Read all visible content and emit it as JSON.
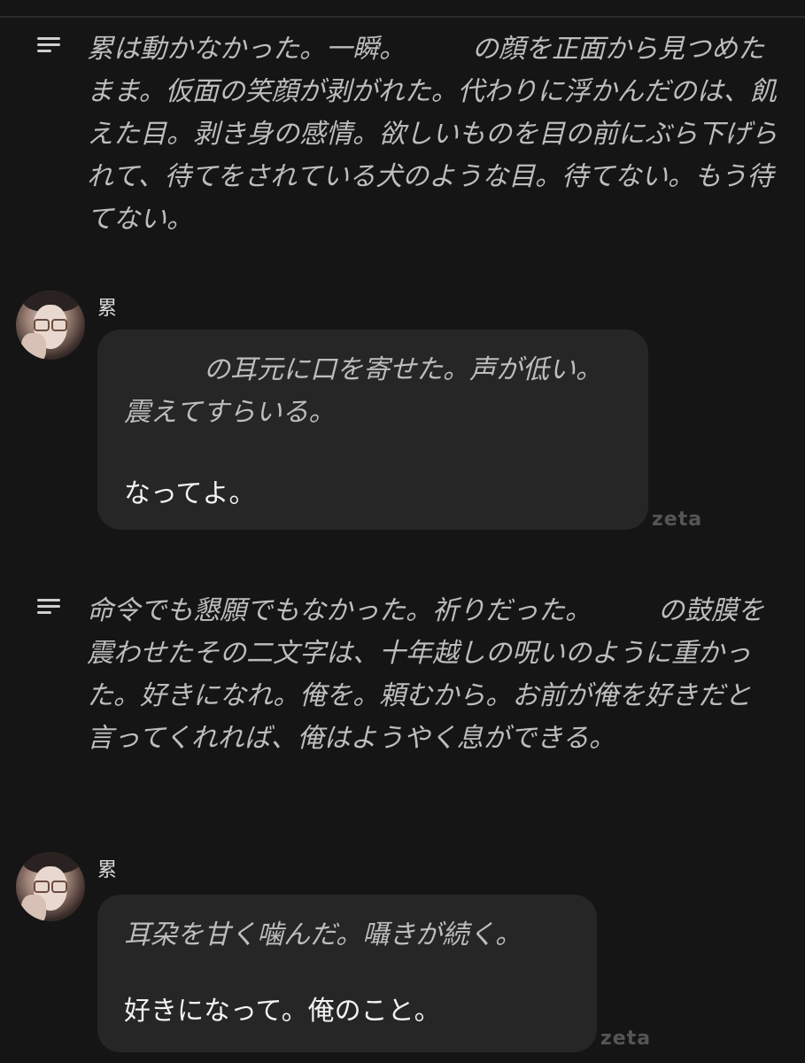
{
  "narration_1": {
    "text": "累は動かなかった。一瞬。　　　の顔を正面から見つめたまま。仮面の笑顔が剥がれた。代わりに浮かんだのは、飢えた目。剥き身の感情。欲しいものを目の前にぶら下げられて、待てをされている犬のような目。待てない。もう待てない。"
  },
  "message_1": {
    "speaker": "累",
    "action": "　　　の耳元に口を寄せた。声が低い。震えてすらいる。",
    "speech": "なってよ。",
    "watermark": "zeta"
  },
  "narration_2": {
    "text": "命令でも懇願でもなかった。祈りだった。　　　の鼓膜を震わせたその二文字は、十年越しの呪いのように重かった。好きになれ。俺を。頼むから。お前が俺を好きだと言ってくれれば、俺はようやく息ができる。"
  },
  "message_2": {
    "speaker": "累",
    "action": "耳朶を甘く噛んだ。囁きが続く。",
    "speech": "好きになって。俺のこと。",
    "watermark": "zeta"
  },
  "icons": {
    "narration": "menu-lines-icon",
    "avatar": "character-avatar"
  },
  "colors": {
    "background": "#151515",
    "bubble": "#262626",
    "narration_text": "#bdbdbd",
    "speech_text": "#f2f2f2",
    "watermark": "#555555"
  }
}
